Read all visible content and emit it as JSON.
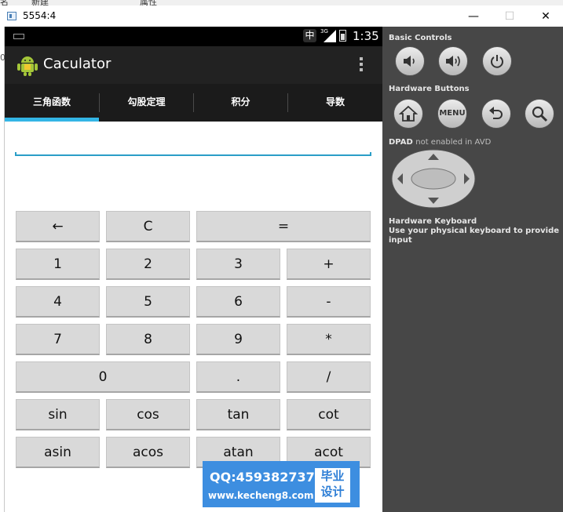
{
  "host": {
    "fragments": [
      "名",
      "新建",
      "属性"
    ],
    "stray_digit": "0"
  },
  "window": {
    "title": "5554:4",
    "controls": {
      "minimize": "—",
      "maximize": "☐",
      "close": "✕"
    }
  },
  "statusbar": {
    "ime": "中",
    "network": "3G",
    "time": "1:35"
  },
  "app": {
    "title": "Caculator"
  },
  "tabs": [
    {
      "label": "三角函数",
      "active": true
    },
    {
      "label": "勾股定理",
      "active": false
    },
    {
      "label": "积分",
      "active": false
    },
    {
      "label": "导数",
      "active": false
    }
  ],
  "display": {
    "value": "",
    "placeholder": ""
  },
  "keys": {
    "back": "←",
    "clear": "C",
    "equals": "=",
    "one": "1",
    "two": "2",
    "three": "3",
    "plus": "+",
    "four": "4",
    "five": "5",
    "six": "6",
    "minus": "-",
    "seven": "7",
    "eight": "8",
    "nine": "9",
    "multiply": "*",
    "zero": "0",
    "dot": ".",
    "divide": "/",
    "sin": "sin",
    "cos": "cos",
    "tan": "tan",
    "cot": "cot",
    "asin": "asin",
    "acos": "acos",
    "atan": "atan",
    "acot": "acot"
  },
  "sidebar": {
    "basic_controls": "Basic Controls",
    "hardware_buttons": "Hardware Buttons",
    "menu_label": "MENU",
    "dpad_title": "DPAD",
    "dpad_note": "not enabled in AVD",
    "keyboard_title": "Hardware Keyboard",
    "keyboard_note": "Use your physical keyboard to provide input"
  },
  "watermark": {
    "qq": "QQ:459382737",
    "url": "www.kecheng8.com",
    "badge_line1": "毕业",
    "badge_line2": "设计"
  },
  "colors": {
    "accent": "#33b5e5",
    "input_line": "#2a9ec7",
    "sidebar_bg": "#474747",
    "key_bg": "#d9d9d9",
    "watermark_bg": "#3d8ee0"
  }
}
